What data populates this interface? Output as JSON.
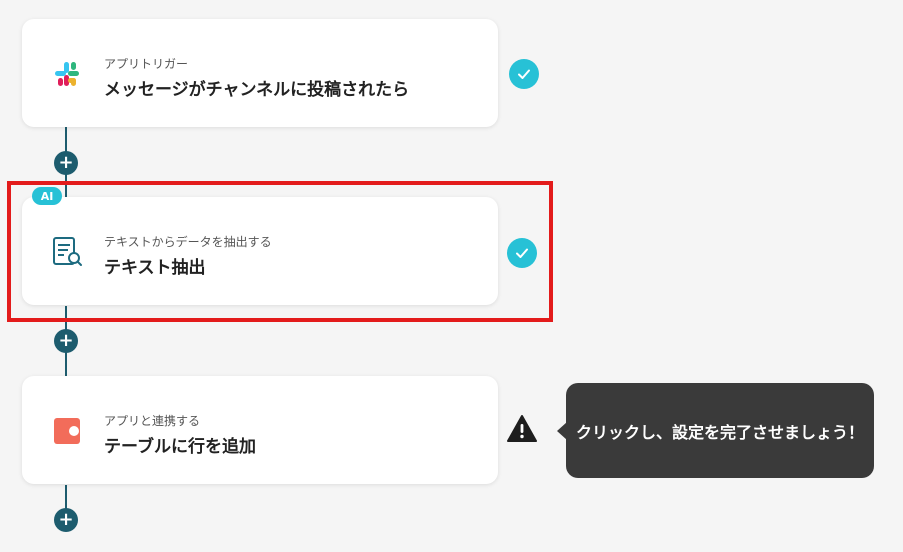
{
  "steps": [
    {
      "subtitle": "アプリトリガー",
      "title": "メッセージがチャンネルに投稿されたら",
      "icon": "slack-icon",
      "status": "complete"
    },
    {
      "badge": "AI",
      "subtitle": "テキストからデータを抽出する",
      "title": "テキスト抽出",
      "icon": "document-search-icon",
      "status": "complete"
    },
    {
      "subtitle": "アプリと連携する",
      "title": "テーブルに行を追加",
      "icon": "app-table-icon",
      "status": "warning"
    }
  ],
  "add_button_symbol": "+",
  "tooltip": {
    "text": "クリックし、設定を完了させましょう！"
  },
  "colors": {
    "accent_teal": "#27c1d6",
    "connector": "#1d5c6e",
    "highlight_red": "#e31b1b",
    "app_icon_orange": "#f26c5a",
    "tooltip_bg": "#3a3a3a"
  }
}
